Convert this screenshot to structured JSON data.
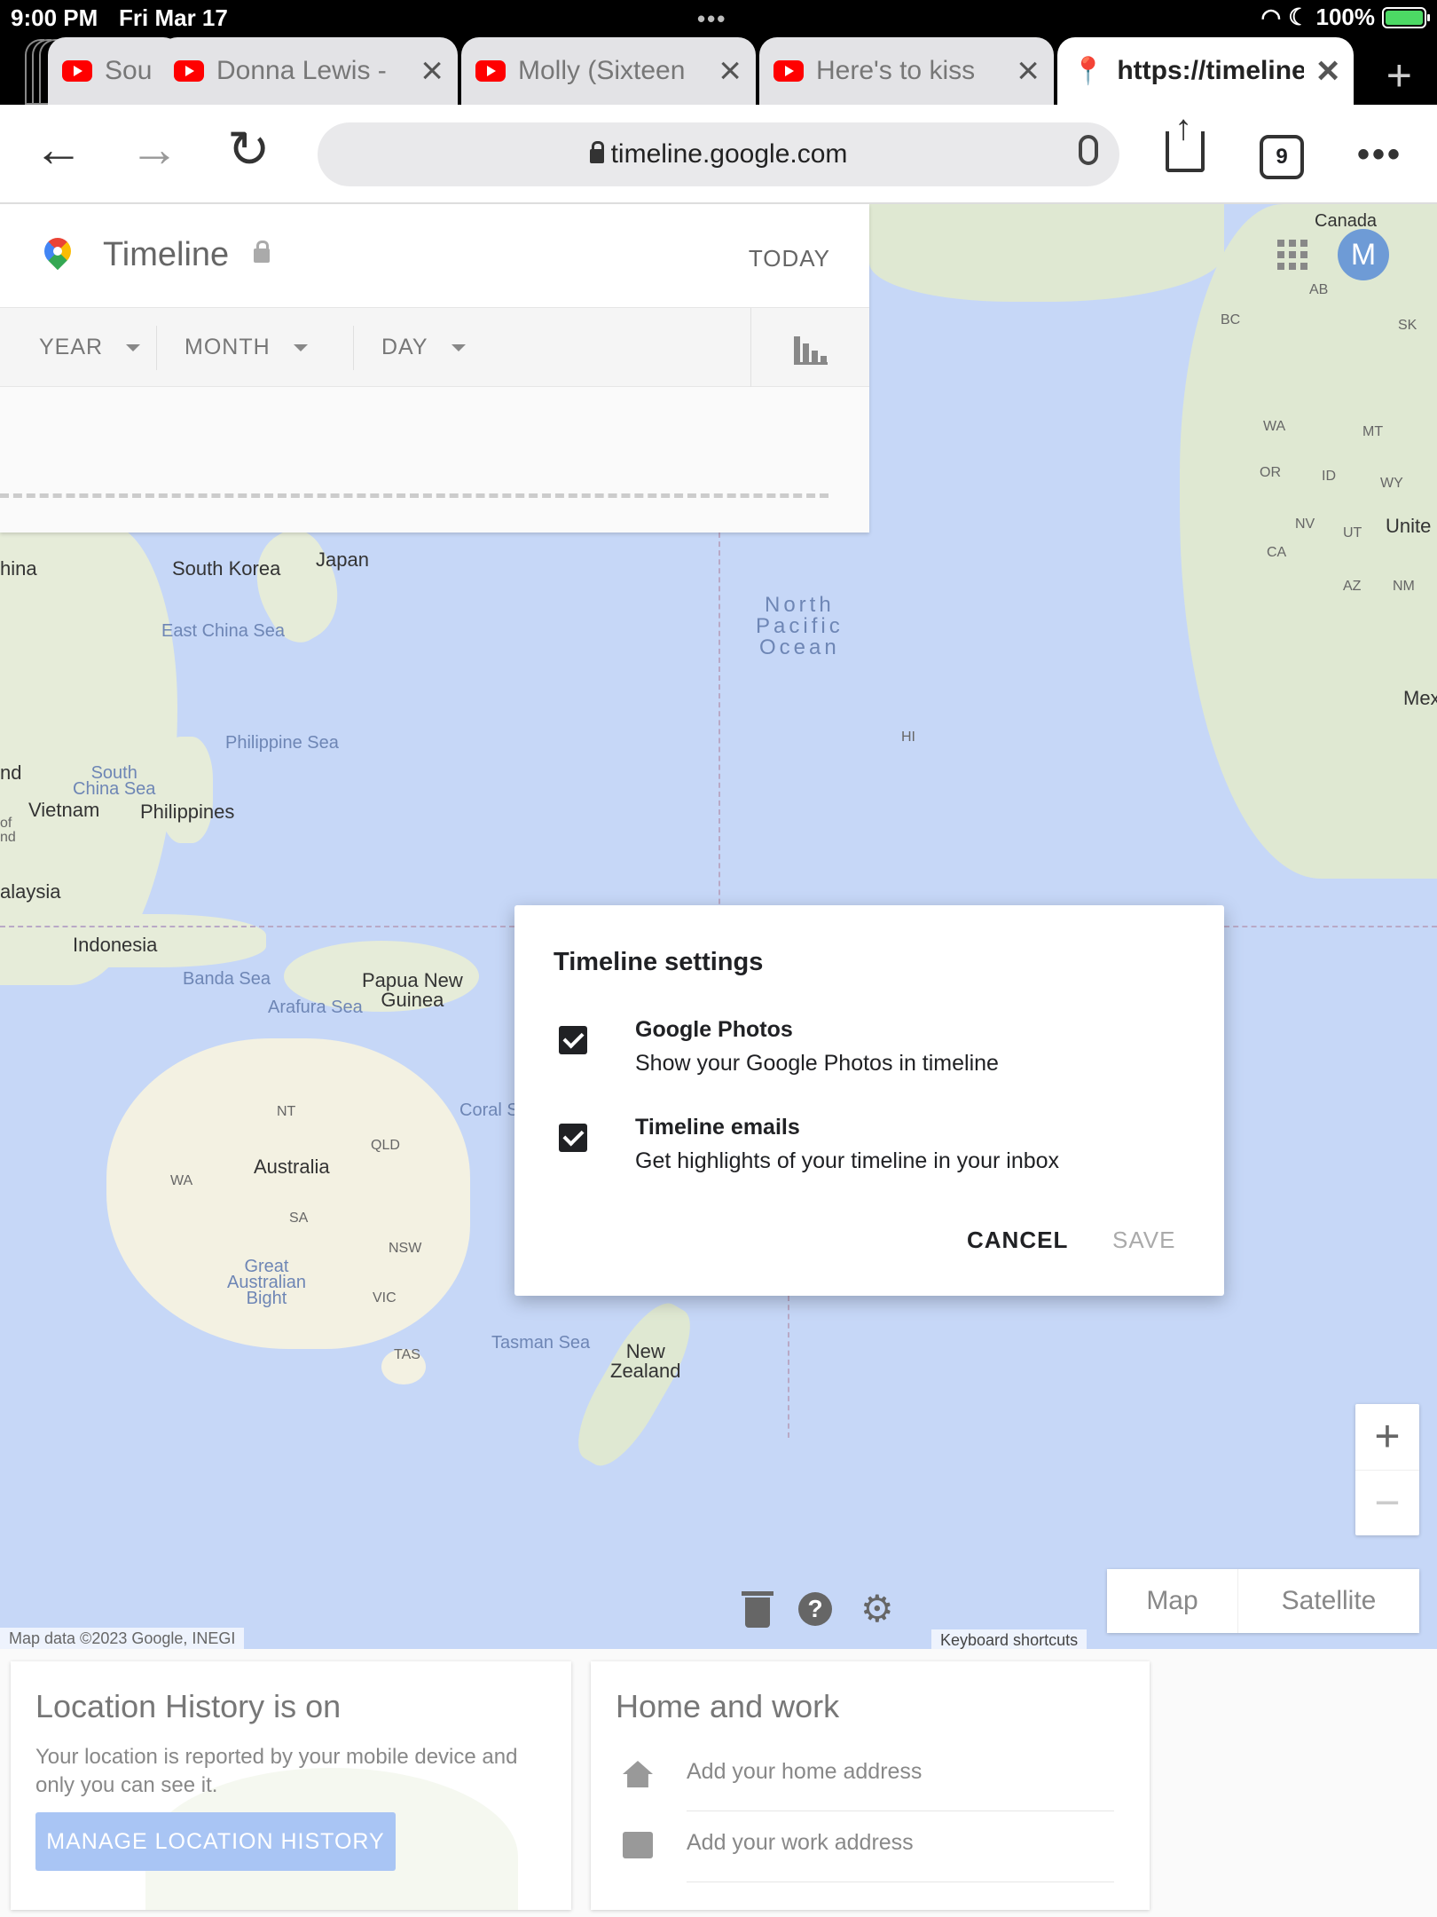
{
  "status_bar": {
    "time": "9:00 PM",
    "date": "Fri Mar 17",
    "battery": "100%"
  },
  "tabs": [
    {
      "title": "Sou",
      "icon": "youtube-icon"
    },
    {
      "title": "Donna Lewis -",
      "icon": "youtube-icon"
    },
    {
      "title": "Molly (Sixteen",
      "icon": "youtube-icon"
    },
    {
      "title": "Here's to kiss",
      "icon": "youtube-icon"
    },
    {
      "title": "https://timeline",
      "icon": "google-maps-pin-icon",
      "active": true
    }
  ],
  "toolbar": {
    "url": "timeline.google.com",
    "tab_count": "9"
  },
  "timeline": {
    "title": "Timeline",
    "today": "TODAY",
    "filters": [
      "YEAR",
      "MONTH",
      "DAY"
    ]
  },
  "map": {
    "labels": {
      "canada": "Canada",
      "ab": "AB",
      "bc": "BC",
      "sk": "SK",
      "wa_us": "WA",
      "mt": "MT",
      "or": "OR",
      "id": "ID",
      "wy": "WY",
      "nv": "NV",
      "ut": "UT",
      "united": "Unite",
      "ca": "CA",
      "az": "AZ",
      "nm": "NM",
      "mex": "Mex",
      "china": "hina",
      "south_korea": "South Korea",
      "japan": "Japan",
      "east_china_sea": "East China Sea",
      "north_pacific": "North\nPacific\nOcean",
      "philippine_sea": "Philippine Sea",
      "hi": "HI",
      "land_nd": "nd",
      "south_china_sea": "South\nChina Sea",
      "vietnam": "Vietnam",
      "philippines": "Philippines",
      "of_nd": "of\nnd",
      "malaysia": "alaysia",
      "indonesia": "Indonesia",
      "banda_sea": "Banda Sea",
      "papua": "Papua New\nGuinea",
      "arafura": "Arafura Sea",
      "coral_sea": "Coral S",
      "nt": "NT",
      "qld": "QLD",
      "australia": "Australia",
      "wa_au": "WA",
      "sa": "SA",
      "nsw": "NSW",
      "great_bight": "Great\nAustralian\nBight",
      "vic": "VIC",
      "tasman": "Tasman Sea",
      "tas": "TAS",
      "new_zealand": "New\nZealand"
    },
    "avatar_letter": "M",
    "map_type_map": "Map",
    "map_type_satellite": "Satellite",
    "attribution": "Map data ©2023 Google, INEGI",
    "keyboard_shortcuts": "Keyboard shortcuts"
  },
  "dialog": {
    "title": "Timeline settings",
    "options": [
      {
        "title": "Google Photos",
        "desc": "Show your Google Photos in timeline",
        "checked": true
      },
      {
        "title": "Timeline emails",
        "desc": "Get highlights of your timeline in your inbox",
        "checked": true
      }
    ],
    "cancel": "CANCEL",
    "save": "SAVE"
  },
  "cards": {
    "location_history": {
      "title": "Location History is on",
      "desc": "Your location is reported by your mobile device and only you can see it.",
      "button": "MANAGE LOCATION HISTORY"
    },
    "home_work": {
      "title": "Home and work",
      "home": "Add your home address",
      "work": "Add your work address"
    }
  }
}
